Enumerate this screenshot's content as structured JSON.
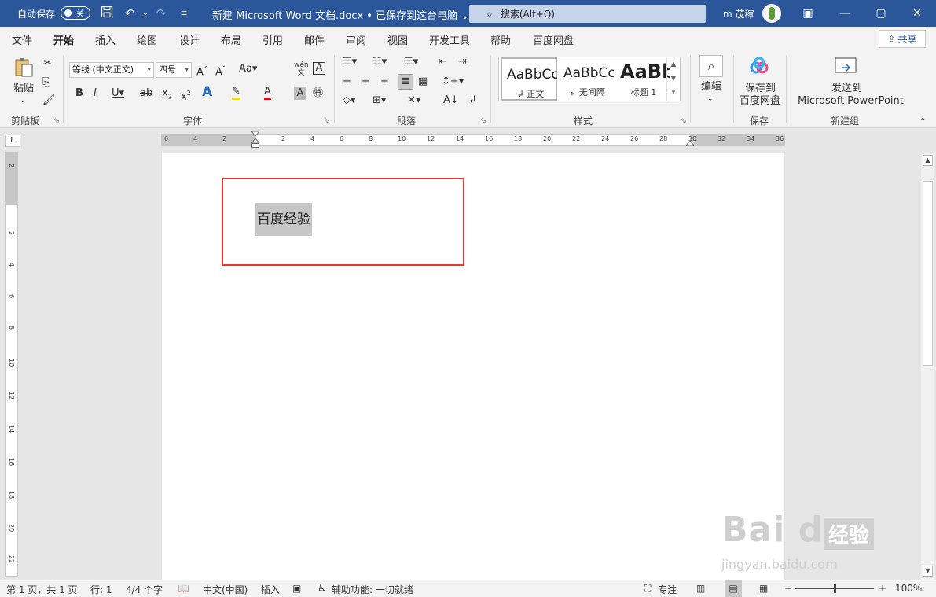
{
  "titlebar": {
    "autosave_label": "自动保存",
    "autosave_state": "关",
    "doc_title": "新建 Microsoft Word 文档.docx • 已保存到这台电脑 ⌄",
    "search_placeholder": "搜索(Alt+Q)",
    "user_name": "m 茂稼",
    "minimize": "—",
    "restore": "▢",
    "close": "✕",
    "ribbon_display": "▣",
    "save_icon": "save-icon",
    "undo_icon": "undo-icon",
    "redo_icon": "redo-icon"
  },
  "tabs": [
    {
      "label": "文件"
    },
    {
      "label": "开始"
    },
    {
      "label": "插入"
    },
    {
      "label": "绘图"
    },
    {
      "label": "设计"
    },
    {
      "label": "布局"
    },
    {
      "label": "引用"
    },
    {
      "label": "邮件"
    },
    {
      "label": "审阅"
    },
    {
      "label": "视图"
    },
    {
      "label": "开发工具"
    },
    {
      "label": "帮助"
    },
    {
      "label": "百度网盘"
    }
  ],
  "share_label": "共享",
  "ribbon": {
    "clipboard": {
      "paste": "粘贴",
      "group": "剪贴板"
    },
    "font": {
      "font_name": "等线 (中文正文)",
      "font_size": "四号",
      "group": "字体"
    },
    "paragraph": {
      "group": "段落"
    },
    "styles": {
      "group": "样式",
      "items": [
        {
          "sample": "AaBbCcDd",
          "name": "↲ 正文"
        },
        {
          "sample": "AaBbCcDd",
          "name": "↲ 无间隔"
        },
        {
          "sample": "AaBb",
          "name": "标题 1"
        }
      ]
    },
    "editing": {
      "label": "编辑"
    },
    "save": {
      "label_line1": "保存到",
      "label_line2": "百度网盘",
      "group": "保存"
    },
    "newgroup": {
      "label_line1": "发送到",
      "label_line2": "Microsoft PowerPoint",
      "group": "新建组"
    }
  },
  "ruler": {
    "h_ticks": [
      "6",
      "4",
      "2",
      "2",
      "4",
      "6",
      "8",
      "10",
      "12",
      "14",
      "16",
      "18",
      "20",
      "22",
      "24",
      "26",
      "28",
      "30",
      "32",
      "34",
      "36"
    ],
    "v_ticks": [
      "2",
      "2",
      "4",
      "6",
      "8",
      "10",
      "12",
      "14",
      "16",
      "18",
      "20",
      "22"
    ]
  },
  "document": {
    "text": "百度经验"
  },
  "status": {
    "page": "第 1 页，共 1 页",
    "line": "行: 1",
    "words": "4/4 个字",
    "language": "中文(中国)",
    "mode": "插入",
    "accessibility": "辅助功能: 一切就绪",
    "focus": "专注",
    "zoom": "100%"
  },
  "watermark": {
    "brand": "Bai du",
    "product": "经验",
    "url": "jingyan.baidu.com"
  }
}
